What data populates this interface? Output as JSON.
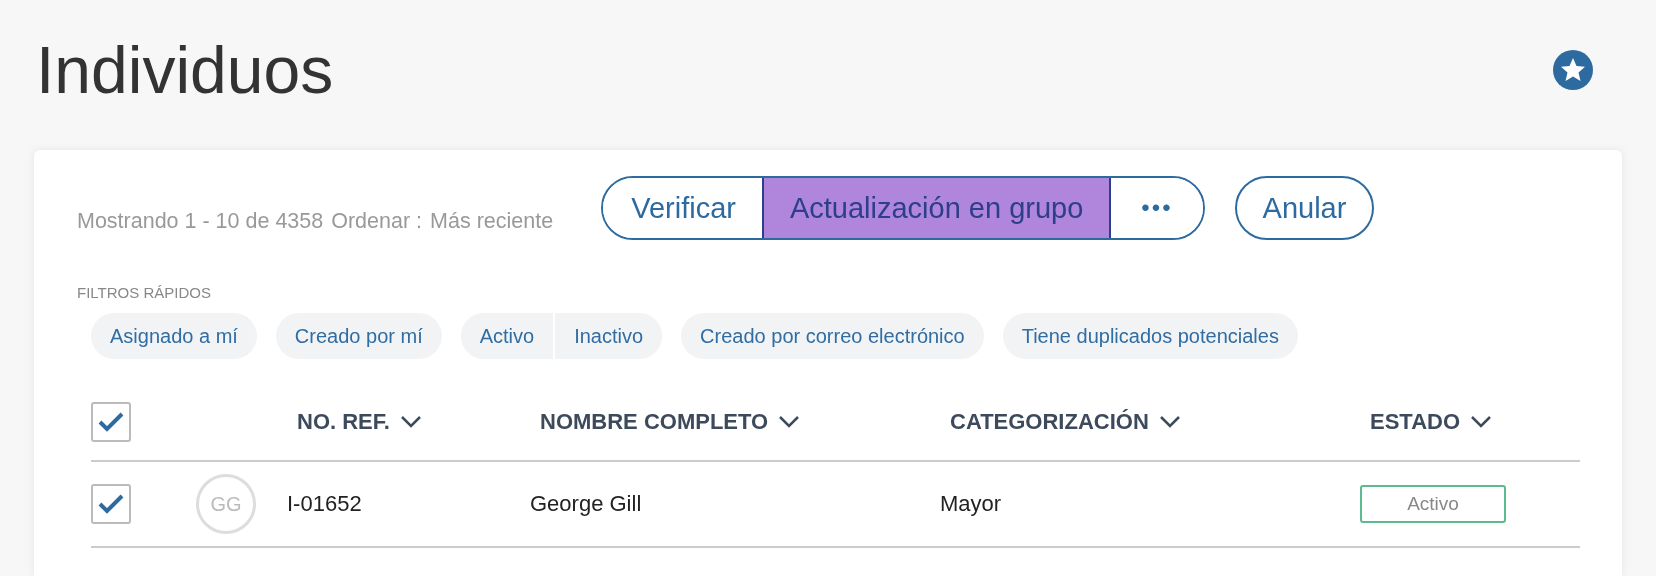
{
  "page": {
    "title": "Individuos",
    "favorite": true
  },
  "summary": {
    "showing": "Mostrando 1 - 10 de 4358",
    "sort_label": "Ordenar :",
    "sort_value": "Más reciente"
  },
  "actions": [
    {
      "label": "Verificar",
      "kind": "text",
      "highlighted": false
    },
    {
      "label": "Actualización en grupo",
      "kind": "text",
      "highlighted": true
    },
    {
      "label": "•••",
      "kind": "more",
      "highlighted": false
    }
  ],
  "cancel_button": "Anular",
  "quick_filters": {
    "title": "FILTROS RÁPIDOS",
    "groups": [
      [
        "Asignado a mí"
      ],
      [
        "Creado por mí"
      ],
      [
        "Activo",
        "Inactivo"
      ],
      [
        "Creado por correo electrónico"
      ],
      [
        "Tiene duplicados potenciales"
      ]
    ]
  },
  "table": {
    "select_all_checked": true,
    "columns": [
      "NO. REF.",
      "NOMBRE COMPLETO",
      "CATEGORIZACIÓN",
      "ESTADO"
    ],
    "rows": [
      {
        "checked": true,
        "initials": "GG",
        "ref": "I-01652",
        "name": "George Gill",
        "category": "Mayor",
        "status": "Activo",
        "color": "#5dba8e"
      }
    ]
  }
}
